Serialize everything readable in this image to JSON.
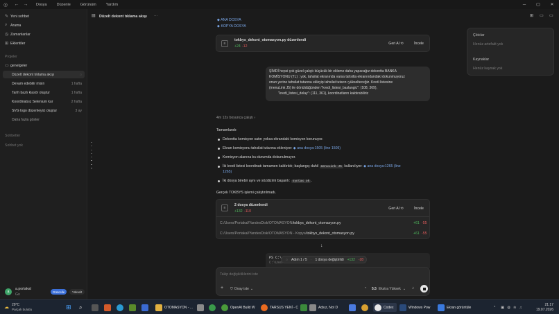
{
  "titlebar": {
    "menus": [
      "Dosya",
      "Düzenle",
      "Görünüm",
      "Yardım"
    ]
  },
  "sidebar": {
    "nav": [
      {
        "label": "Yeni sohbet",
        "icon": "compose-icon"
      },
      {
        "label": "Arama",
        "icon": "search-icon"
      },
      {
        "label": "Zamanlanlar",
        "icon": "clock-icon"
      },
      {
        "label": "Eklentiler",
        "icon": "grid-icon"
      }
    ],
    "projects_heading": "Projeler",
    "project_name": "genelgeler",
    "chats": [
      {
        "title": "Düzelt dekont tıklama akışı",
        "age": ""
      },
      {
        "title": "Devam edebilir misin",
        "age": "1 hafta"
      },
      {
        "title": "Tarih bazlı klasör oluştur",
        "age": "1 hafta"
      },
      {
        "title": "Koordinatsız Selenium kur",
        "age": "2 hafta"
      },
      {
        "title": "SVG logo düzenleyici oluştur",
        "age": "3 ay"
      }
    ],
    "show_more": "Daha fazla göster",
    "chats_heading": "Sohbetler",
    "no_chats": "Sohbet yok",
    "user_name": "a.portakal",
    "user_plan": "Go",
    "upgrade_label": "Güncelle",
    "update_label": "Yükselt"
  },
  "header": {
    "title": "Düzelt dekont tıklama akışı",
    "more": "···"
  },
  "content": {
    "file_link_1": "ANA DOSYA",
    "file_link_2": "KOPYA DOSYA",
    "edit_card_1": {
      "title": "tokbys_dekont_otomasyon.py düzenlendi",
      "added": "+24",
      "removed": "-12",
      "undo": "Geri Al",
      "undo_key": "⟲",
      "review": "İncele"
    },
    "user_message": [
      "ŞİMDİ hepsi çok güzel çalıştı küçücük bir ekleme daha yapacağız dekontta BANKA",
      "KOMİSYONU (TL) : yok, tahsilat ekranında varsa tahsilta ekranındandaki dokunmuyoruz",
      "onun yerine tahsilat tutarına ekleyip tahsilat tutarını yükselteceğiz. Kredi listesine",
      "(menuLink J5) ile dönüldüğünden \"kredi_listesi_baslangic\": (108, 369),",
      "\"kredi_listesi_delay\": (111, 361), koordinatların kaldırabiliriz"
    ],
    "work_time": "4m 12s boyunca çalıştı",
    "done_label": "Tamamlandı:",
    "bullets": [
      {
        "text": "Dekontta komisyon satırı yoksa ekrandaki komisyon korunuyor."
      },
      {
        "text": "Ekran komisyonu tahsilat tutarına ekleniyor:",
        "link": "ana dosya:1505 (line 1505)"
      },
      {
        "text": "Komisyon alanına bu durumda dokunulmuyor."
      },
      {
        "text": "İki kredi listesi koordinatı tamamen kaldırıldı; başlangıç dahil",
        "code": "menuLink J5",
        "text2": "kullanılıyor:",
        "link": "ana dosya:1265 (line",
        "link2": "1265)"
      },
      {
        "text": "İki dosya birebir aynı ve sözdizimi başarılı:",
        "code": "syntax ok",
        "text2": "."
      }
    ],
    "summary": "Gerçek TOKBYS işlemi çalıştırılmadı.",
    "edit_card_2": {
      "title": "2 dosya düzenlendi",
      "added": "+132",
      "removed": "-110",
      "undo": "Geri Al",
      "undo_key": "⟲",
      "review": "İncele",
      "files": [
        {
          "path": "C:/Users/Portakal/YandexDisk/OTOMASYON/",
          "name": "tokbys_dekont_otomasyon.py",
          "added": "+61",
          "removed": "-55"
        },
        {
          "path": "C:/Users/Portakal/YandexDisk/OTOMASYON - Kopya/",
          "name": "tokbys_dekont_otomasyon.py",
          "added": "+61",
          "removed": "-55"
        }
      ]
    },
    "terminal_line_1": "PS C:\\",
    "terminal_line_2": "C:\\Users"
  },
  "status_pill": {
    "step": "Adım 1 / 5",
    "changed": "1 dosya değiştirildi",
    "added": "+132",
    "removed": "-28"
  },
  "composer": {
    "placeholder": "Takip değişikliklerini iste",
    "permission": "Onay iste",
    "model": "5.5",
    "effort": "Ekstra Yüksek"
  },
  "right_panel": {
    "outputs_heading": "Çıktılar",
    "no_outputs": "Henüz artefakt yok",
    "sources_heading": "Kaynaklar",
    "no_sources": "Henüz kaynak yok"
  },
  "taskbar": {
    "weather_temp": "29°C",
    "weather_desc": "Parçalı bulutlu",
    "apps": [
      {
        "label": "OTOMASYON - ...",
        "color": "#e0b040"
      },
      {
        "label": "OpenAI Build W",
        "color": "#4a9a3a"
      },
      {
        "label": "TARSUS YENİ - C",
        "color": "#e86a20"
      },
      {
        "label": "Adsız, Not D",
        "color": "#3b8a3b"
      },
      {
        "label": "Codex",
        "color": "#e8e8e8"
      },
      {
        "label": "Windows Pow",
        "color": "#2a4a7a"
      },
      {
        "label": "Ekran görüntüle",
        "color": "#3a7adf"
      }
    ],
    "time": "21:17",
    "date": "19.07.2026"
  },
  "colors": {
    "link": "#7aa7e8",
    "added": "#4fba5e",
    "removed": "#e05b5b",
    "accent": "#3b6fd8"
  }
}
